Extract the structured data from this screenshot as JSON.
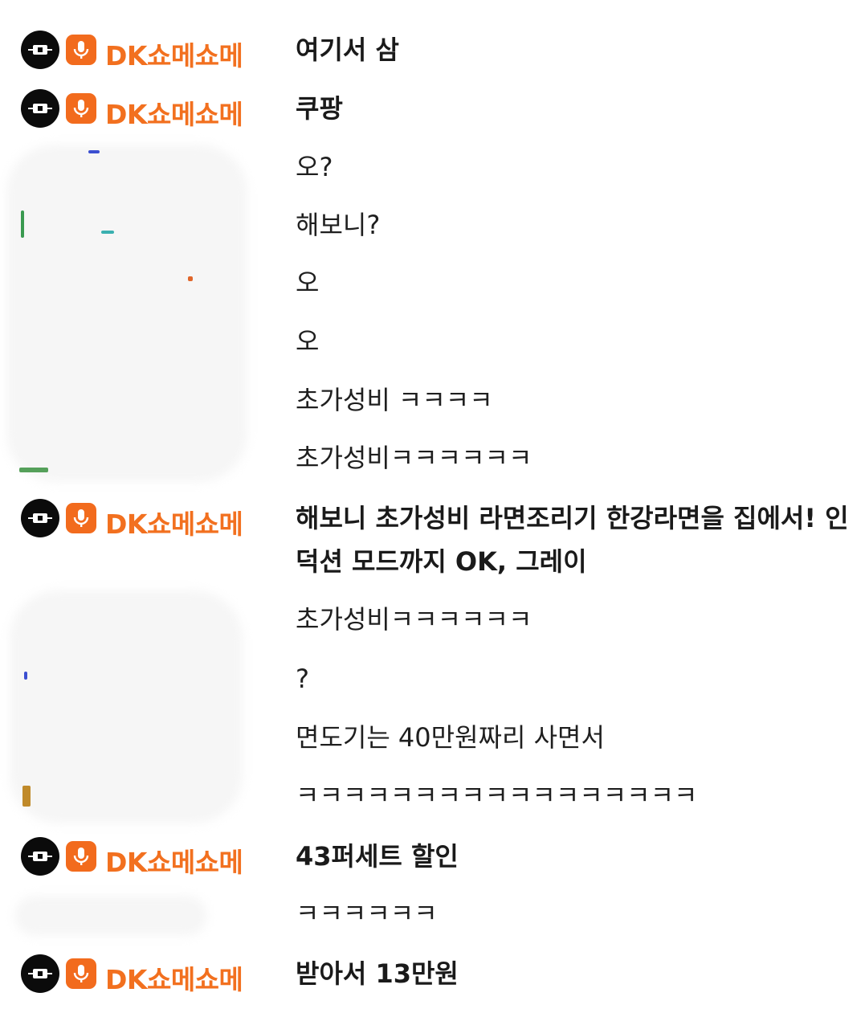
{
  "chat": {
    "host_nickname": "DK쇼메쇼메",
    "top_partial_user": "",
    "top_partial_message": "",
    "messages": [
      {
        "host": true,
        "text": "여기서 삼"
      },
      {
        "host": true,
        "text": "쿠팡"
      },
      {
        "host": false,
        "text": "오?"
      },
      {
        "host": false,
        "text": "해보니?"
      },
      {
        "host": false,
        "text": "오"
      },
      {
        "host": false,
        "text": "오"
      },
      {
        "host": false,
        "text": "초가성비 ㅋㅋㅋㅋ"
      },
      {
        "host": false,
        "text": "초가성비ㅋㅋㅋㅋㅋㅋ"
      },
      {
        "host": true,
        "text": "해보니 초가성비 라면조리기 한강라면을 집에서! 인덕션 모드까지 OK, 그레이"
      },
      {
        "host": false,
        "text": "초가성비ㅋㅋㅋㅋㅋㅋ"
      },
      {
        "host": false,
        "text": "?"
      },
      {
        "host": false,
        "text": "면도기는 40만원짜리 사면서"
      },
      {
        "host": false,
        "text": "ㅋㅋㅋㅋㅋㅋㅋㅋㅋㅋㅋㅋㅋㅋㅋㅋㅋ"
      },
      {
        "host": true,
        "text": "43퍼세트 할인"
      },
      {
        "host": false,
        "text": "ㅋㅋㅋㅋㅋㅋ"
      },
      {
        "host": true,
        "text": "받아서 13만원"
      }
    ],
    "icons": {
      "avatar": "host-avatar-icon",
      "badge": "microphone-icon"
    },
    "colors": {
      "nickname": "#f2701f",
      "badge": "#f26b1d",
      "text": "#1f1f1f"
    }
  }
}
